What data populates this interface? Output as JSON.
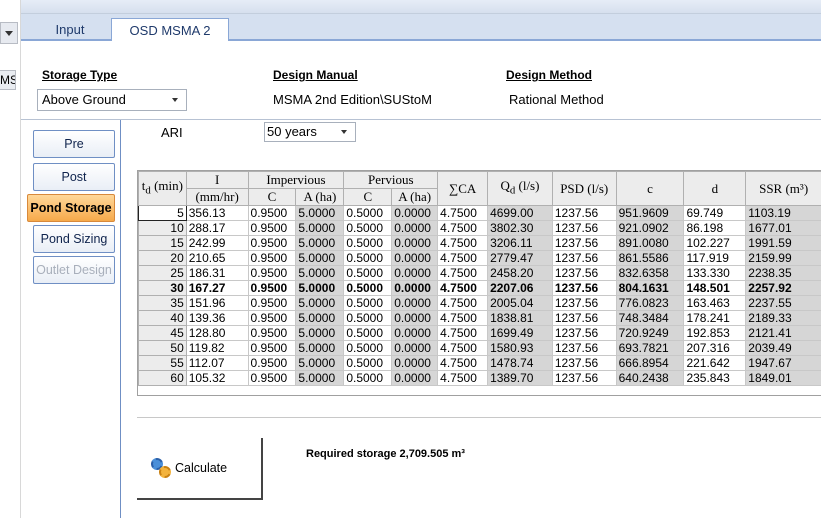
{
  "left_strip": {
    "ms_text": "MS"
  },
  "tabs": [
    {
      "label": "Input",
      "active": false
    },
    {
      "label": "OSD MSMA 2",
      "active": true
    }
  ],
  "header": {
    "storage_type_label": "Storage Type",
    "storage_type_value": "Above Ground",
    "design_manual_label": "Design Manual",
    "design_manual_value": "MSMA 2nd Edition\\SUStoM",
    "design_method_label": "Design Method",
    "design_method_value": "Rational Method"
  },
  "side_nav": [
    {
      "label": "Pre",
      "state": "normal"
    },
    {
      "label": "Post",
      "state": "normal"
    },
    {
      "label": "Pond Storage",
      "state": "active"
    },
    {
      "label": "Pond Sizing",
      "state": "normal"
    },
    {
      "label": "Outlet Design",
      "state": "disabled"
    }
  ],
  "ari": {
    "label": "ARI",
    "value": "50 years"
  },
  "grid": {
    "headers": {
      "td_main": "t",
      "td_sub": "d",
      "td_unit": " (min)",
      "i_top": "I",
      "i_unit": "(mm/hr)",
      "impervious": "Impervious",
      "pervious": "Pervious",
      "c": "C",
      "a_ha": "A (ha)",
      "sigma_ca": "∑CA",
      "qd_main": "Q",
      "qd_sub": "d",
      "qd_unit": " (l/s)",
      "psd": "PSD (l/s)",
      "c_lower": "c",
      "d_lower": "d",
      "ssr": "SSR (m³)"
    },
    "rows": [
      [
        "5",
        "356.13",
        "0.9500",
        "5.0000",
        "0.5000",
        "0.0000",
        "4.7500",
        "4699.00",
        "1237.56",
        "951.9609",
        "69.749",
        "1103.19"
      ],
      [
        "10",
        "288.17",
        "0.9500",
        "5.0000",
        "0.5000",
        "0.0000",
        "4.7500",
        "3802.30",
        "1237.56",
        "921.0902",
        "86.198",
        "1677.01"
      ],
      [
        "15",
        "242.99",
        "0.9500",
        "5.0000",
        "0.5000",
        "0.0000",
        "4.7500",
        "3206.11",
        "1237.56",
        "891.0080",
        "102.227",
        "1991.59"
      ],
      [
        "20",
        "210.65",
        "0.9500",
        "5.0000",
        "0.5000",
        "0.0000",
        "4.7500",
        "2779.47",
        "1237.56",
        "861.5586",
        "117.919",
        "2159.99"
      ],
      [
        "25",
        "186.31",
        "0.9500",
        "5.0000",
        "0.5000",
        "0.0000",
        "4.7500",
        "2458.20",
        "1237.56",
        "832.6358",
        "133.330",
        "2238.35"
      ],
      [
        "30",
        "167.27",
        "0.9500",
        "5.0000",
        "0.5000",
        "0.0000",
        "4.7500",
        "2207.06",
        "1237.56",
        "804.1631",
        "148.501",
        "2257.92"
      ],
      [
        "35",
        "151.96",
        "0.9500",
        "5.0000",
        "0.5000",
        "0.0000",
        "4.7500",
        "2005.04",
        "1237.56",
        "776.0823",
        "163.463",
        "2237.55"
      ],
      [
        "40",
        "139.36",
        "0.9500",
        "5.0000",
        "0.5000",
        "0.0000",
        "4.7500",
        "1838.81",
        "1237.56",
        "748.3484",
        "178.241",
        "2189.33"
      ],
      [
        "45",
        "128.80",
        "0.9500",
        "5.0000",
        "0.5000",
        "0.0000",
        "4.7500",
        "1699.49",
        "1237.56",
        "720.9249",
        "192.853",
        "2121.41"
      ],
      [
        "50",
        "119.82",
        "0.9500",
        "5.0000",
        "0.5000",
        "0.0000",
        "4.7500",
        "1580.93",
        "1237.56",
        "693.7821",
        "207.316",
        "2039.49"
      ],
      [
        "55",
        "112.07",
        "0.9500",
        "5.0000",
        "0.5000",
        "0.0000",
        "4.7500",
        "1478.74",
        "1237.56",
        "666.8954",
        "221.642",
        "1947.67"
      ],
      [
        "60",
        "105.32",
        "0.9500",
        "5.0000",
        "0.5000",
        "0.0000",
        "4.7500",
        "1389.70",
        "1237.56",
        "640.2438",
        "235.843",
        "1849.01"
      ]
    ],
    "bold_row_index": 5,
    "selected_row_index": 0
  },
  "calculate_button": {
    "label": "Calculate"
  },
  "required_storage": "Required storage 2,709.505 m³",
  "colors": {
    "active_tab_orange": "#f6a94a",
    "accent_blue": "#8aa7d6",
    "grey_cell": "#d6d6d6"
  }
}
